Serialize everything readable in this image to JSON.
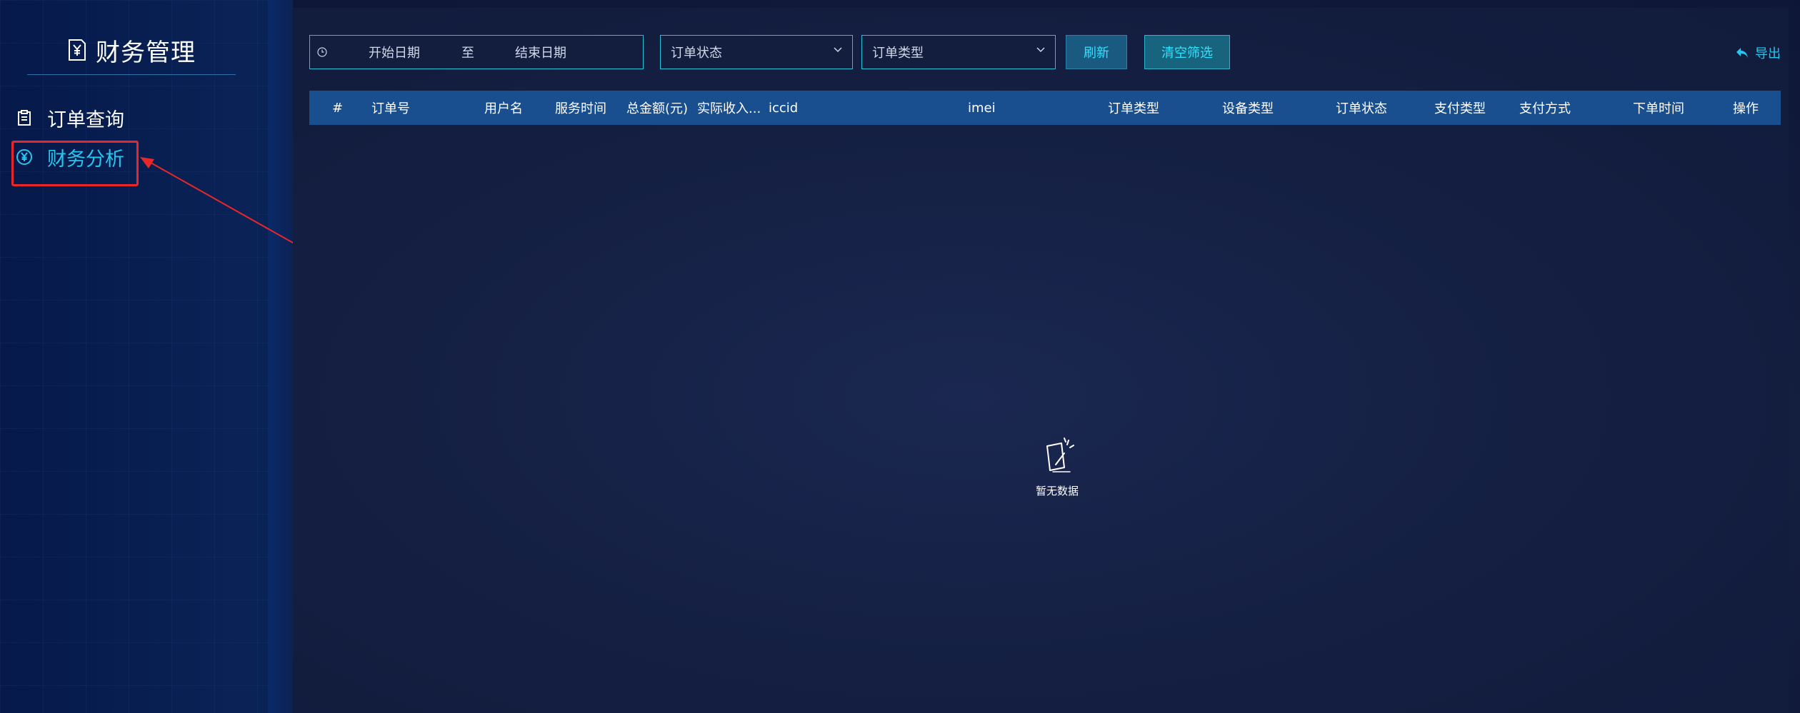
{
  "sidebar": {
    "title": "财务管理",
    "items": [
      {
        "label": "订单查询",
        "icon": "clipboard-icon",
        "active": false
      },
      {
        "label": "财务分析",
        "icon": "yen-circle-icon",
        "active": true
      }
    ]
  },
  "filters": {
    "start_placeholder": "开始日期",
    "separator": "至",
    "end_placeholder": "结束日期",
    "order_status_placeholder": "订单状态",
    "order_type_placeholder": "订单类型",
    "refresh_label": "刷新",
    "clear_label": "清空筛选",
    "export_label": "导出"
  },
  "table": {
    "columns": [
      "#",
      "订单号",
      "用户名",
      "服务时间",
      "总金额(元)",
      "实际收入...",
      "iccid",
      "imei",
      "订单类型",
      "设备类型",
      "订单状态",
      "支付类型",
      "支付方式",
      "下单时间",
      "操作"
    ],
    "rows": [],
    "empty_text": "暂无数据"
  },
  "colors": {
    "accent": "#27c6ef",
    "header_bg": "#1a4f8f",
    "highlight": "#e8272a"
  }
}
